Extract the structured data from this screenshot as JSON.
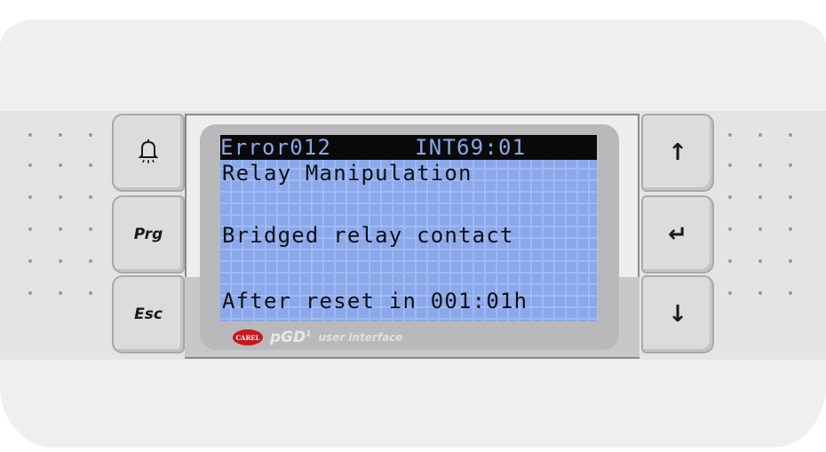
{
  "buttons": {
    "alarm_icon": "bell-icon",
    "prg_label": "Prg",
    "esc_label": "Esc",
    "up_icon": "↑",
    "enter_icon": "↵",
    "down_icon": "↓"
  },
  "display": {
    "header": "Error012      INT69:01",
    "line1": "Relay Manipulation",
    "line2": "",
    "line3": "Bridged relay contact",
    "line4": "",
    "line5": "After reset in 001:01h"
  },
  "branding": {
    "logo_text": "CAREL",
    "product": "pGD",
    "product_sup": "1",
    "subtitle": "user interface"
  },
  "colors": {
    "lcd_background": "#8aa8ea",
    "logo_red": "#c9161d"
  }
}
